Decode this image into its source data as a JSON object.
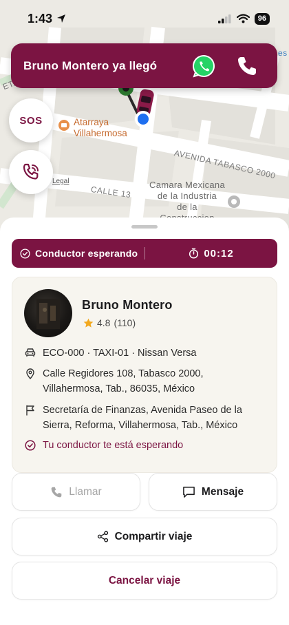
{
  "status_bar": {
    "time": "1:43",
    "battery": "96"
  },
  "map": {
    "streets": [
      "AVENIDA TABASCO 2000",
      "CALLE 13",
      "ETARIO"
    ],
    "poi": "Atarraya\nVillahermosa",
    "place": "Camara Mexicana\nde la Industria\nde la\nConstruccion",
    "legal": "Legal",
    "edge_label": "es"
  },
  "banner": {
    "text": "Bruno Montero ya llegó",
    "whatsapp_icon": "whatsapp-icon",
    "phone_icon": "phone-icon"
  },
  "fab": {
    "sos_label": "SOS",
    "call_icon": "phone-call-icon"
  },
  "colors": {
    "accent": "#7b1442",
    "card_bg": "#f7f5ef",
    "star": "#f2a81d"
  },
  "wait_bar": {
    "status": "Conductor esperando",
    "timer": "00:12"
  },
  "driver": {
    "name": "Bruno Montero",
    "rating": "4.8",
    "reviews": "(110)",
    "vehicle": "ECO-000 · TAXI-01 · Nissan Versa",
    "pickup": "Calle Regidores 108, Tabasco 2000, Villahermosa, Tab., 86035, México",
    "destination": "Secretaría de Finanzas, Avenida Paseo de la Sierra, Reforma, Villahermosa, Tab., México",
    "note": "Tu conductor te está esperando"
  },
  "actions": {
    "call": "Llamar",
    "message": "Mensaje",
    "share": "Compartir viaje",
    "cancel": "Cancelar viaje"
  }
}
